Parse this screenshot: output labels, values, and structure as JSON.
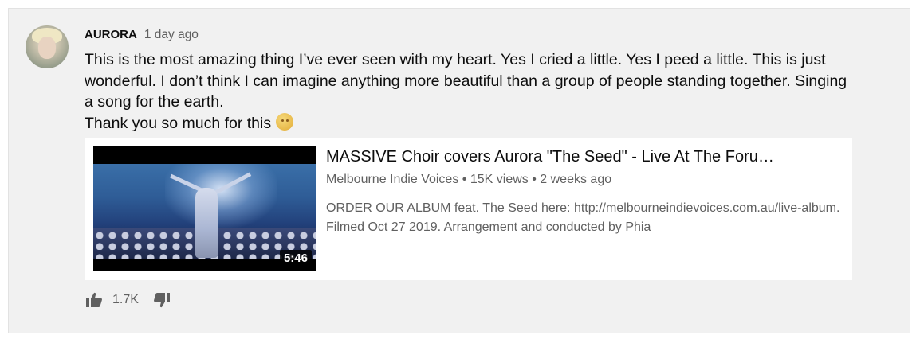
{
  "comment": {
    "author": "AURORA",
    "time": "1 day ago",
    "text_line1": "This is the most amazing thing I’ve ever seen with my heart. Yes I cried a little. Yes I peed a little. This is just wonderful. I don’t think I can imagine anything more beautiful than a group of people standing together. Singing a song for the earth.",
    "text_line2": "Thank you so much for this",
    "emoji_icon": "smiling-sun-emoji"
  },
  "video": {
    "title": "MASSIVE Choir covers Aurora \"The Seed\" - Live At The Foru…",
    "channel": "Melbourne Indie Voices",
    "views": "15K views",
    "age": "2 weeks ago",
    "separator": "•",
    "description": "ORDER OUR ALBUM feat. The Seed here: http://melbourneindievoices.com.au/live-album. Filmed Oct 27 2019. Arrangement and conducted by Phia",
    "duration": "5:46"
  },
  "actions": {
    "like_count": "1.7K",
    "like_icon": "thumbs-up-icon",
    "dislike_icon": "thumbs-down-icon"
  },
  "colors": {
    "card_background": "#f1f1f1",
    "secondary_text": "#606060",
    "primary_text": "#0d0d0d"
  }
}
